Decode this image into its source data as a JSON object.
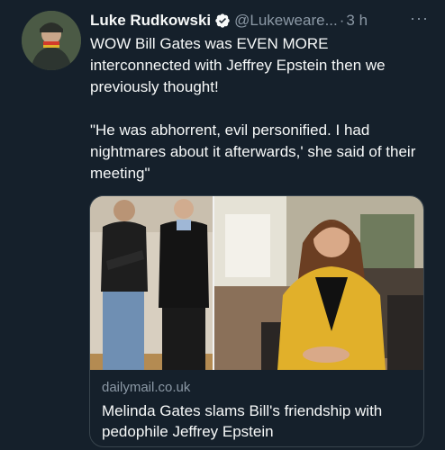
{
  "tweet": {
    "author_name": "Luke Rudkowski",
    "handle": "@Lukeweare...",
    "separator": "·",
    "time": "3 h",
    "more": "···",
    "text_line1": "WOW Bill Gates was EVEN MORE interconnected with Jeffrey Epstein then we previously thought!",
    "text_line2": "\"He was abhorrent, evil personified. I had nightmares about it afterwards,' she said of their meeting\""
  },
  "link_card": {
    "domain": "dailymail.co.uk",
    "headline": "Melinda Gates slams Bill's friendship with pedophile Jeffrey Epstein"
  },
  "colors": {
    "background": "#15202b",
    "text": "#f7f9f9",
    "muted": "#8b98a5",
    "verified": "#1d9bf0",
    "border": "#38444d"
  }
}
